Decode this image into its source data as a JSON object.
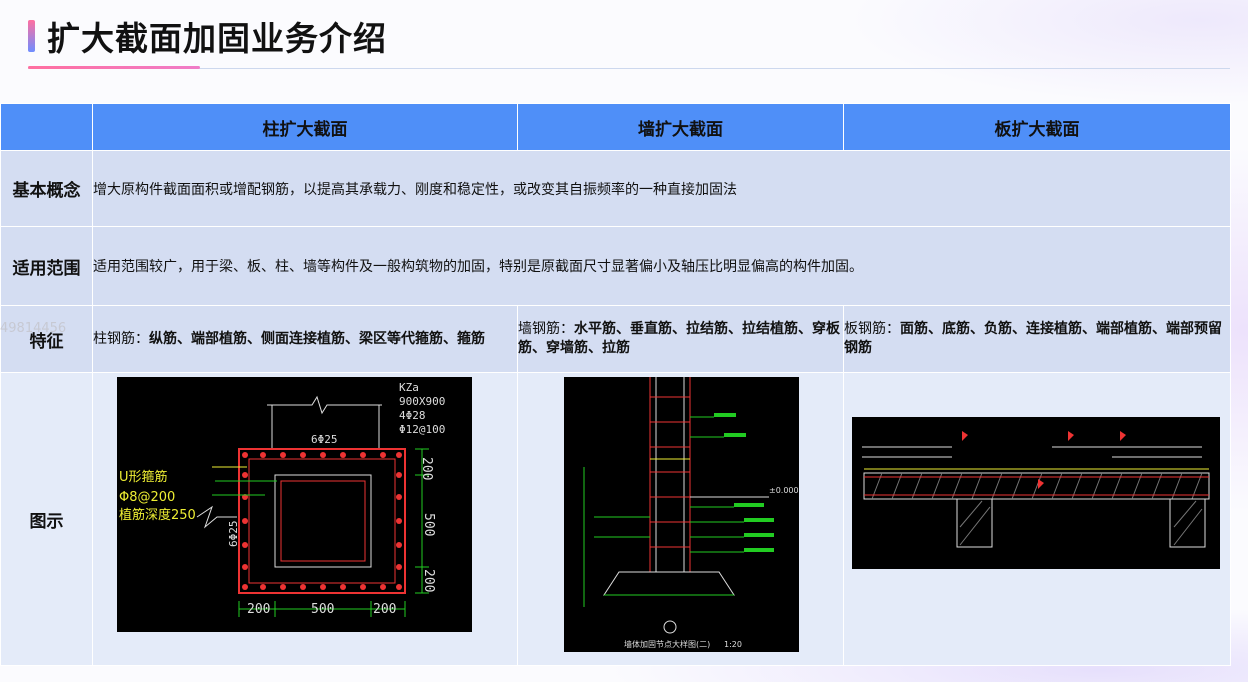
{
  "title": "扩大截面加固业务介绍",
  "columns": [
    "柱扩大截面",
    "墙扩大截面",
    "板扩大截面"
  ],
  "rows": {
    "concept": {
      "label": "基本概念",
      "text": "增大原构件截面面积或增配钢筋，以提高其承载力、刚度和稳定性，或改变其自振频率的一种直接加固法"
    },
    "scope": {
      "label": "适用范围",
      "text": "适用范围较广，用于梁、板、柱、墙等构件及一般构筑物的加固，特别是原截面尺寸显著偏小及轴压比明显偏高的构件加固。"
    },
    "feature": {
      "label": "特征",
      "column": {
        "prefix": "柱钢筋：",
        "bold": "纵筋、端部植筋、侧面连接植筋、梁区等代箍筋、箍筋"
      },
      "wall": {
        "prefix": "墙钢筋：",
        "bold": "水平筋、垂直筋、拉结筋、拉结植筋、穿板筋、穿墙筋、拉筋"
      },
      "slab": {
        "prefix": "板钢筋：",
        "bold": "面筋、底筋、负筋、连接植筋、端部植筋、端部预留钢筋"
      }
    },
    "diagram": {
      "label": "图示"
    }
  },
  "watermark": "49814456",
  "column_drawing": {
    "kz": "KZa",
    "size": "900X900",
    "rebar1": "4Φ28",
    "rebar2": "Φ12@100",
    "top": "6Φ25",
    "side": "6Φ25",
    "ustir": "U形箍筋",
    "ustir_spec": "Φ8@200",
    "anchor": "植筋深度250",
    "dims_bottom": [
      "200",
      "500",
      "200"
    ],
    "dims_right": [
      "200",
      "500",
      "200"
    ]
  },
  "wall_drawing": {
    "elev": "±0.000",
    "caption": "墙体加固节点大样图(二)",
    "scale": "1:20"
  },
  "colors": {
    "header": "#4f8ff8",
    "row": "#d4ddf2",
    "image_row": "#e4ebf9"
  }
}
